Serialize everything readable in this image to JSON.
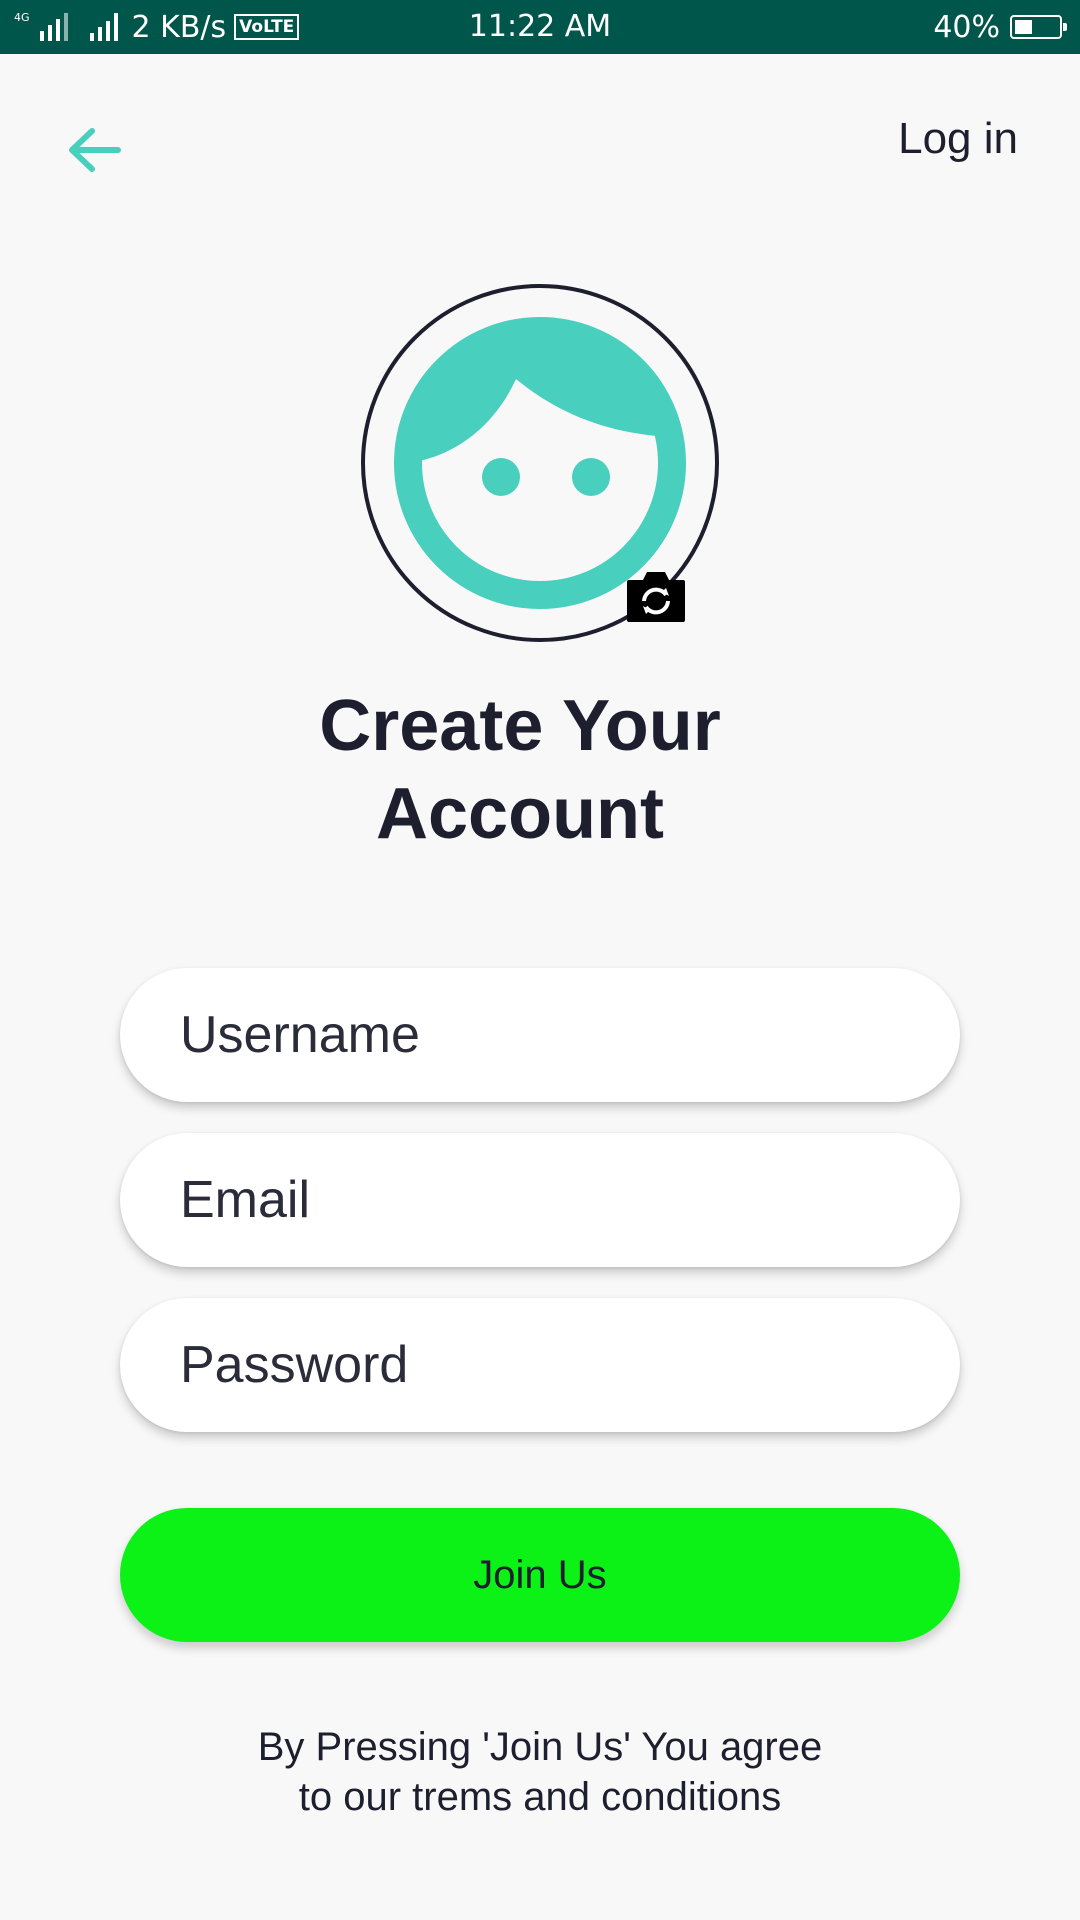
{
  "status_bar": {
    "network_tag": "4G",
    "speed": "2 KB/s",
    "volte": "VoLTE",
    "time": "11:22 AM",
    "battery_percent_label": "40%",
    "battery_level": 0.4
  },
  "nav": {
    "back_icon": "arrow-left-icon",
    "login_label": "Log in"
  },
  "avatar": {
    "face_icon": "user-face-icon",
    "camera_icon": "camera-switch-icon",
    "accent_color": "#48cfbe"
  },
  "title": {
    "line1": "Create Your",
    "line2": "Account"
  },
  "form": {
    "username_placeholder": "Username",
    "email_placeholder": "Email",
    "password_placeholder": "Password",
    "username_value": "",
    "email_value": "",
    "password_value": ""
  },
  "join_button": {
    "label": "Join Us",
    "color": "#0cf216"
  },
  "terms": {
    "line1": "By Pressing 'Join Us' You agree",
    "line2": "to our trems and conditions"
  },
  "colors": {
    "status_bar": "#00564a",
    "background": "#f8f8f8",
    "text": "#1d1f2e"
  }
}
